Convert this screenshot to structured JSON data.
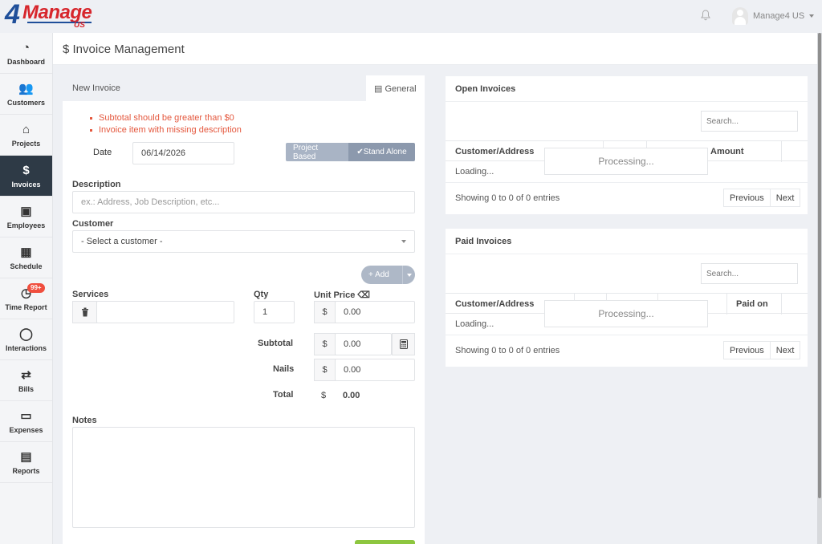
{
  "app": {
    "logo_prefix": "4",
    "logo_word": "Manage",
    "logo_suffix": "US"
  },
  "topbar": {
    "user_name": "Manage4 US",
    "bell_icon": "bell-icon"
  },
  "sidebar": {
    "items": [
      {
        "label": "Dashboard",
        "icon": "gauge-icon",
        "glyph": "◔"
      },
      {
        "label": "Customers",
        "icon": "users-icon",
        "glyph": "👥"
      },
      {
        "label": "Projects",
        "icon": "home-icon",
        "glyph": "⌂"
      },
      {
        "label": "Invoices",
        "icon": "dollar-icon",
        "glyph": "$"
      },
      {
        "label": "Employees",
        "icon": "id-badge-icon",
        "glyph": "▣"
      },
      {
        "label": "Schedule",
        "icon": "calendar-icon",
        "glyph": "▦"
      },
      {
        "label": "Time Report",
        "icon": "clock-icon",
        "glyph": "◷",
        "badge": "99+"
      },
      {
        "label": "Interactions",
        "icon": "chat-icon",
        "glyph": "◯"
      },
      {
        "label": "Bills",
        "icon": "retweet-icon",
        "glyph": "⇄"
      },
      {
        "label": "Expenses",
        "icon": "credit-card-icon",
        "glyph": "▭"
      },
      {
        "label": "Reports",
        "icon": "excel-file-icon",
        "glyph": "▤"
      }
    ],
    "active_index": 3
  },
  "page": {
    "title": "$ Invoice Management"
  },
  "invoice": {
    "tab_new": "New Invoice",
    "tab_general": "General",
    "errors": [
      "Subtotal should be greater than $0",
      "Invoice item with missing description"
    ],
    "date_label": "Date",
    "date_value": "06/14/2026",
    "mode_project": "Project Based",
    "mode_stand": "✔Stand Alone",
    "description_label": "Description",
    "description_placeholder": "ex.: Address, Job Description, etc...",
    "customer_label": "Customer",
    "customer_value": "- Select a customer -",
    "add_label": "+ Add",
    "services_label": "Services",
    "qty_label": "Qty",
    "qty_value": "1",
    "unit_price_label": "Unit Price",
    "currency": "$",
    "unit_price_value": "0.00",
    "subtotal_label": "Subtotal",
    "subtotal_value": "0.00",
    "nails_label": "Nails",
    "nails_value": "0.00",
    "total_label": "Total",
    "total_value": "0.00",
    "notes_label": "Notes"
  },
  "open_invoices": {
    "title": "Open Invoices",
    "search_placeholder": "Search...",
    "col_customer": "Customer/Address",
    "col_amount": "Amount",
    "loading": "Loading...",
    "processing": "Processing...",
    "info": "Showing 0 to 0 of 0 entries",
    "prev": "Previous",
    "next": "Next"
  },
  "paid_invoices": {
    "title": "Paid Invoices",
    "search_placeholder": "Search...",
    "col_customer": "Customer/Address",
    "col_paid_on": "Paid on",
    "loading": "Loading...",
    "processing": "Processing...",
    "info": "Showing 0 to 0 of 0 entries",
    "prev": "Previous",
    "next": "Next"
  },
  "colors": {
    "accent_dark": "#2e3a46",
    "error": "#e4573d",
    "badge": "#f04e3e",
    "save_green": "#8dc63f"
  }
}
